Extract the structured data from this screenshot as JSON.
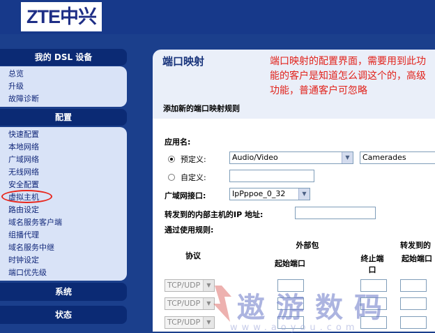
{
  "logo": {
    "text": "ZTE中兴"
  },
  "sidebar": {
    "sections": {
      "dsl_device": {
        "title": "我的 DSL 设备",
        "items": [
          {
            "label": "总览"
          },
          {
            "label": "升级"
          },
          {
            "label": "故障诊断"
          }
        ]
      },
      "config": {
        "title": "配置",
        "items": [
          {
            "label": "快速配置"
          },
          {
            "label": "本地网络"
          },
          {
            "label": "广域网络"
          },
          {
            "label": "无线网络"
          },
          {
            "label": "安全配置"
          },
          {
            "label": "虚拟主机"
          },
          {
            "label": "路由设定"
          },
          {
            "label": "域名服务客户端"
          },
          {
            "label": "组播代理"
          },
          {
            "label": "域名服务中继"
          },
          {
            "label": "时钟设定"
          },
          {
            "label": "端口优先级"
          }
        ]
      },
      "system": {
        "title": "系统"
      },
      "status": {
        "title": "状态"
      }
    }
  },
  "main": {
    "title": "端口映射",
    "annotation": "端口映射的配置界面，需要用到此功能的客户是知道怎么调这个的，高级功能，普通客户可忽略",
    "add_rule_title": "添加新的端口映射规则",
    "form": {
      "app_name_label": "应用名:",
      "predefined_label": "预定义:",
      "predefined_value": "Audio/Video",
      "predefined_app_value": "Camerades",
      "custom_label": "自定义:",
      "custom_value": "",
      "wan_interface_label": "广域网接口:",
      "wan_interface_value": "IpPppoe_0_32",
      "internal_ip_label": "转发到的内部主机的IP 地址:",
      "internal_ip_value": "",
      "rules_label": "通过使用规则:",
      "table": {
        "protocol_header": "协议",
        "external_header": "外部包",
        "forward_header": "转发到的",
        "start_port_header": "起始端口",
        "end_port_header": "终止端口",
        "forward_start_header": "起始端口",
        "rows": [
          {
            "protocol": "TCP/UDP"
          },
          {
            "protocol": "TCP/UDP"
          },
          {
            "protocol": "TCP/UDP"
          }
        ]
      }
    }
  },
  "watermark": {
    "text": "遨游数码",
    "url": "www.aoyou.com"
  },
  "colors": {
    "accent": "#17398a",
    "annotation": "#e1221b",
    "highlight_ring": "#e8261c"
  }
}
